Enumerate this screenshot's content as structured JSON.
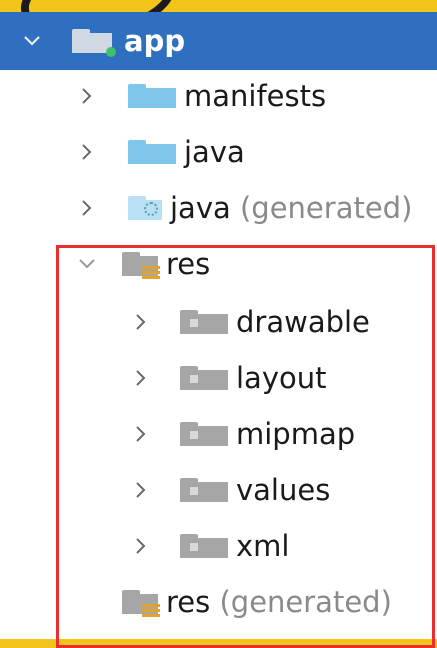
{
  "tree": {
    "root": {
      "label": "app",
      "expanded": true,
      "selected": true
    },
    "items": [
      {
        "label": "manifests",
        "expanded": false,
        "icon": "folder-icon"
      },
      {
        "label": "java",
        "expanded": false,
        "icon": "folder-icon"
      },
      {
        "label": "java",
        "suffix": "(generated)",
        "expanded": false,
        "icon": "generated-folder-icon"
      },
      {
        "label": "res",
        "expanded": true,
        "icon": "resources-folder-icon",
        "children": [
          {
            "label": "drawable",
            "icon": "folder-icon"
          },
          {
            "label": "layout",
            "icon": "folder-icon"
          },
          {
            "label": "mipmap",
            "icon": "folder-icon"
          },
          {
            "label": "values",
            "icon": "folder-icon"
          },
          {
            "label": "xml",
            "icon": "folder-icon"
          }
        ]
      },
      {
        "label": "res",
        "suffix": "(generated)",
        "icon": "resources-folder-icon"
      }
    ]
  },
  "colors": {
    "selection": "#2f6fc0",
    "highlight_border": "#ea2e2e",
    "folder_blue": "#7fc7ea",
    "folder_grey": "#a6a6a6",
    "generated_text": "#8a8a8a"
  }
}
